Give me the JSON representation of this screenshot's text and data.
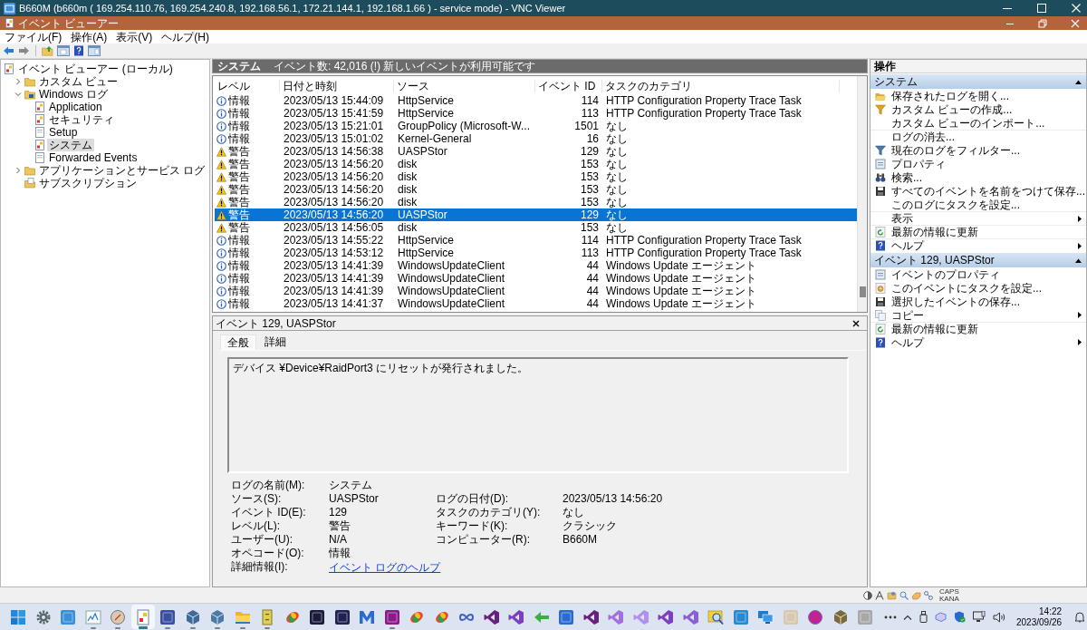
{
  "vnc_window": {
    "title": "B660M (b660m ( 169.254.110.76, 169.254.240.8, 192.168.56.1, 172.21.144.1, 192.168.1.66 ) - service mode) - VNC Viewer"
  },
  "app_window": {
    "title": "イベント ビューアー"
  },
  "menu": [
    "ファイル(F)",
    "操作(A)",
    "表示(V)",
    "ヘルプ(H)"
  ],
  "tree": [
    {
      "kind": "root",
      "label": "イベント ビューアー (ローカル)",
      "selected": false,
      "children": [
        {
          "kind": "folder",
          "label": "カスタム ビュー",
          "selected": false,
          "expanded": false
        },
        {
          "kind": "log_folder",
          "label": "Windows ログ",
          "selected": false,
          "expanded": true,
          "children": [
            {
              "kind": "log",
              "label": "Application",
              "selected": false
            },
            {
              "kind": "log",
              "label": "セキュリティ",
              "selected": false
            },
            {
              "kind": "plain_log",
              "label": "Setup",
              "selected": false
            },
            {
              "kind": "log",
              "label": "システム",
              "selected": true
            },
            {
              "kind": "plain_log",
              "label": "Forwarded Events",
              "selected": false
            }
          ]
        },
        {
          "kind": "folder",
          "label": "アプリケーションとサービス ログ",
          "selected": false,
          "expanded": false
        },
        {
          "kind": "subscription",
          "label": "サブスクリプション",
          "selected": false
        }
      ]
    }
  ],
  "event_list": {
    "log_name": "システム",
    "summary": "イベント数: 42,016 (!) 新しいイベントが利用可能です",
    "columns": [
      "レベル",
      "日付と時刻",
      "ソース",
      "イベント ID",
      "タスクのカテゴリ"
    ],
    "rows": [
      {
        "kind": "info",
        "severity": "情報",
        "date": "2023/05/13 15:44:09",
        "source": "HttpService",
        "event_id": "114",
        "category": "HTTP Configuration Property Trace Task",
        "selected": false
      },
      {
        "kind": "info",
        "severity": "情報",
        "date": "2023/05/13 15:41:59",
        "source": "HttpService",
        "event_id": "113",
        "category": "HTTP Configuration Property Trace Task",
        "selected": false
      },
      {
        "kind": "info",
        "severity": "情報",
        "date": "2023/05/13 15:21:01",
        "source": "GroupPolicy (Microsoft-W...",
        "event_id": "1501",
        "category": "なし",
        "selected": false
      },
      {
        "kind": "info",
        "severity": "情報",
        "date": "2023/05/13 15:01:02",
        "source": "Kernel-General",
        "event_id": "16",
        "category": "なし",
        "selected": false
      },
      {
        "kind": "warning",
        "severity": "警告",
        "date": "2023/05/13 14:56:38",
        "source": "UASPStor",
        "event_id": "129",
        "category": "なし",
        "selected": false
      },
      {
        "kind": "warning",
        "severity": "警告",
        "date": "2023/05/13 14:56:20",
        "source": "disk",
        "event_id": "153",
        "category": "なし",
        "selected": false
      },
      {
        "kind": "warning",
        "severity": "警告",
        "date": "2023/05/13 14:56:20",
        "source": "disk",
        "event_id": "153",
        "category": "なし",
        "selected": false
      },
      {
        "kind": "warning",
        "severity": "警告",
        "date": "2023/05/13 14:56:20",
        "source": "disk",
        "event_id": "153",
        "category": "なし",
        "selected": false
      },
      {
        "kind": "warning",
        "severity": "警告",
        "date": "2023/05/13 14:56:20",
        "source": "disk",
        "event_id": "153",
        "category": "なし",
        "selected": false
      },
      {
        "kind": "warning",
        "severity": "警告",
        "date": "2023/05/13 14:56:20",
        "source": "UASPStor",
        "event_id": "129",
        "category": "なし",
        "selected": true
      },
      {
        "kind": "warning",
        "severity": "警告",
        "date": "2023/05/13 14:56:05",
        "source": "disk",
        "event_id": "153",
        "category": "なし",
        "selected": false
      },
      {
        "kind": "info",
        "severity": "情報",
        "date": "2023/05/13 14:55:22",
        "source": "HttpService",
        "event_id": "114",
        "category": "HTTP Configuration Property Trace Task",
        "selected": false
      },
      {
        "kind": "info",
        "severity": "情報",
        "date": "2023/05/13 14:53:12",
        "source": "HttpService",
        "event_id": "113",
        "category": "HTTP Configuration Property Trace Task",
        "selected": false
      },
      {
        "kind": "info",
        "severity": "情報",
        "date": "2023/05/13 14:41:39",
        "source": "WindowsUpdateClient",
        "event_id": "44",
        "category": "Windows Update エージェント",
        "selected": false
      },
      {
        "kind": "info",
        "severity": "情報",
        "date": "2023/05/13 14:41:39",
        "source": "WindowsUpdateClient",
        "event_id": "44",
        "category": "Windows Update エージェント",
        "selected": false
      },
      {
        "kind": "info",
        "severity": "情報",
        "date": "2023/05/13 14:41:39",
        "source": "WindowsUpdateClient",
        "event_id": "44",
        "category": "Windows Update エージェント",
        "selected": false
      },
      {
        "kind": "info",
        "severity": "情報",
        "date": "2023/05/13 14:41:37",
        "source": "WindowsUpdateClient",
        "event_id": "44",
        "category": "Windows Update エージェント",
        "selected": false
      }
    ]
  },
  "event_detail": {
    "title": "イベント 129, UASPStor",
    "tabs": [
      {
        "label": "全般",
        "selected": true
      },
      {
        "label": "詳細",
        "selected": false
      }
    ],
    "message": "デバイス ¥Device¥RaidPort3 にリセットが発行されました。",
    "fields_left": [
      {
        "label": "ログの名前(M):",
        "value": "システム",
        "kind": "text"
      },
      {
        "label": "ソース(S):",
        "value": "UASPStor",
        "kind": "text"
      },
      {
        "label": "イベント ID(E):",
        "value": "129",
        "kind": "text"
      },
      {
        "label": "レベル(L):",
        "value": "警告",
        "kind": "text"
      },
      {
        "label": "ユーザー(U):",
        "value": "N/A",
        "kind": "text"
      },
      {
        "label": "オペコード(O):",
        "value": "情報",
        "kind": "text"
      },
      {
        "label": "詳細情報(I):",
        "value": "イベント ログのヘルプ",
        "kind": "link"
      }
    ],
    "fields_right": [
      {
        "label": "ログの日付(D):",
        "value": "2023/05/13 14:56:20"
      },
      {
        "label": "タスクのカテゴリ(Y):",
        "value": "なし"
      },
      {
        "label": "キーワード(K):",
        "value": "クラシック"
      },
      {
        "label": "コンピューター(R):",
        "value": "B660M"
      }
    ]
  },
  "actions": {
    "title": "操作",
    "sections": [
      {
        "title": "システム",
        "expanded": true,
        "items": [
          {
            "label": "保存されたログを開く...",
            "kind": "open",
            "submenu": false,
            "divider": false
          },
          {
            "label": "カスタム ビューの作成...",
            "kind": "custom_view",
            "submenu": false,
            "divider": false
          },
          {
            "label": "カスタム ビューのインポート...",
            "kind": "none",
            "submenu": false,
            "divider": false
          },
          {
            "label": "ログの消去...",
            "kind": "none",
            "submenu": false,
            "divider": true
          },
          {
            "label": "現在のログをフィルター...",
            "kind": "filter",
            "submenu": false,
            "divider": false
          },
          {
            "label": "プロパティ",
            "kind": "properties",
            "submenu": false,
            "divider": false
          },
          {
            "label": "検索...",
            "kind": "find",
            "submenu": false,
            "divider": false
          },
          {
            "label": "すべてのイベントを名前をつけて保存...",
            "kind": "save",
            "submenu": false,
            "divider": false
          },
          {
            "label": "このログにタスクを設定...",
            "kind": "none",
            "submenu": false,
            "divider": false
          },
          {
            "label": "表示",
            "kind": "none",
            "submenu": true,
            "divider": true
          },
          {
            "label": "最新の情報に更新",
            "kind": "refresh",
            "submenu": false,
            "divider": true
          },
          {
            "label": "ヘルプ",
            "kind": "help",
            "submenu": true,
            "divider": true
          }
        ]
      },
      {
        "title": "イベント 129, UASPStor",
        "expanded": true,
        "items": [
          {
            "label": "イベントのプロパティ",
            "kind": "properties",
            "submenu": false,
            "divider": false
          },
          {
            "label": "このイベントにタスクを設定...",
            "kind": "task",
            "submenu": false,
            "divider": false
          },
          {
            "label": "選択したイベントの保存...",
            "kind": "save",
            "submenu": false,
            "divider": false
          },
          {
            "label": "コピー",
            "kind": "copy",
            "submenu": true,
            "divider": false
          },
          {
            "label": "最新の情報に更新",
            "kind": "refresh",
            "submenu": false,
            "divider": true
          },
          {
            "label": "ヘルプ",
            "kind": "help",
            "submenu": true,
            "divider": false
          }
        ]
      }
    ]
  },
  "status_bar": {
    "indicators": [
      "CAPS",
      "KANA"
    ]
  },
  "taskbar": {
    "apps": [
      {
        "running": false,
        "active": false
      },
      {
        "running": false,
        "active": false
      },
      {
        "running": false,
        "active": false
      },
      {
        "running": true,
        "active": false
      },
      {
        "running": true,
        "active": false
      },
      {
        "running": true,
        "active": true
      },
      {
        "running": true,
        "active": false
      },
      {
        "running": true,
        "active": false
      },
      {
        "running": true,
        "active": false
      },
      {
        "running": true,
        "active": false
      },
      {
        "running": true,
        "active": false
      },
      {
        "running": false,
        "active": false
      },
      {
        "running": false,
        "active": false
      },
      {
        "running": false,
        "active": false
      },
      {
        "running": false,
        "active": false
      },
      {
        "running": true,
        "active": false
      },
      {
        "running": false,
        "active": false
      },
      {
        "running": false,
        "active": false
      },
      {
        "running": false,
        "active": false
      },
      {
        "running": false,
        "active": false
      },
      {
        "running": false,
        "active": false
      },
      {
        "running": false,
        "active": false
      },
      {
        "running": false,
        "active": false
      },
      {
        "running": false,
        "active": false
      },
      {
        "running": false,
        "active": false
      },
      {
        "running": false,
        "active": false
      },
      {
        "running": false,
        "active": false
      },
      {
        "running": false,
        "active": false
      },
      {
        "running": false,
        "active": false
      },
      {
        "running": false,
        "active": false
      },
      {
        "running": false,
        "active": false
      },
      {
        "running": false,
        "active": false
      },
      {
        "running": false,
        "active": false
      },
      {
        "running": false,
        "active": false
      },
      {
        "running": false,
        "active": false
      }
    ],
    "time": "14:22",
    "date": "2023/09/26"
  }
}
